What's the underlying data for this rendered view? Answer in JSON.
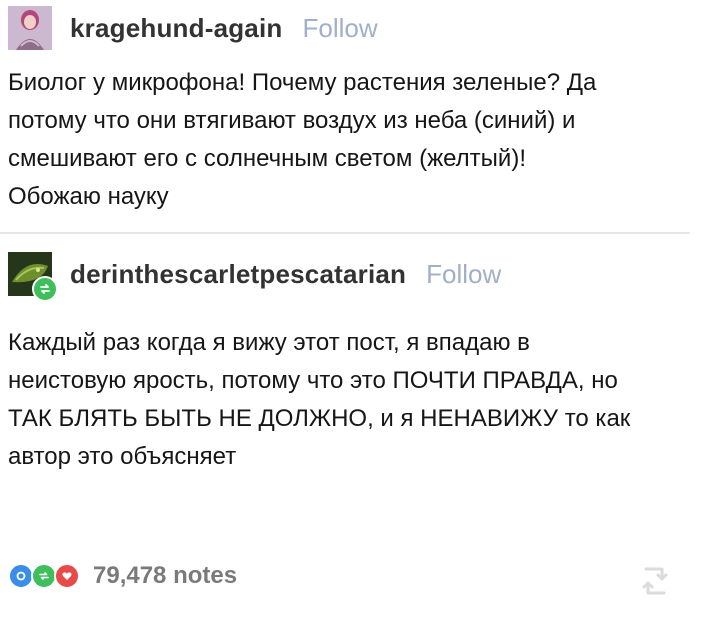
{
  "colors": {
    "follow": "#9fb0c7",
    "username": "#333333",
    "text": "#161616",
    "notes": "#7a7a7a",
    "reply_blue": "#3b8ee8",
    "reblog_green": "#3fbf5b",
    "like_red": "#e84a4a"
  },
  "posts": [
    {
      "avatar_icon": "user-avatar",
      "username": "kragehund-again",
      "follow_label": "Follow",
      "lines": [
        "Биолог у микрофона! Почему растения зеленые? Да",
        "потому что они втягивают воздух из неба (синий) и",
        "смешивают его с солнечным светом (желтый)!",
        "Обожаю науку"
      ]
    },
    {
      "avatar_icon": "user-avatar",
      "badge_icon": "reblog-icon",
      "username": "derinthescarletpescatarian",
      "follow_label": "Follow",
      "lines": [
        "Каждый раз когда я вижу этот пост, я впадаю в",
        "неистовую ярость, потому что это ПОЧТИ ПРАВДА, но",
        "ТАК БЛЯТЬ БЫТЬ НЕ ДОЛЖНО, и я НЕНАВИЖУ то как",
        "автор это объясняет"
      ]
    }
  ],
  "notes": {
    "icons": [
      "reply-icon",
      "reblog-icon",
      "heart-icon"
    ],
    "count_label": "79,478 notes"
  }
}
